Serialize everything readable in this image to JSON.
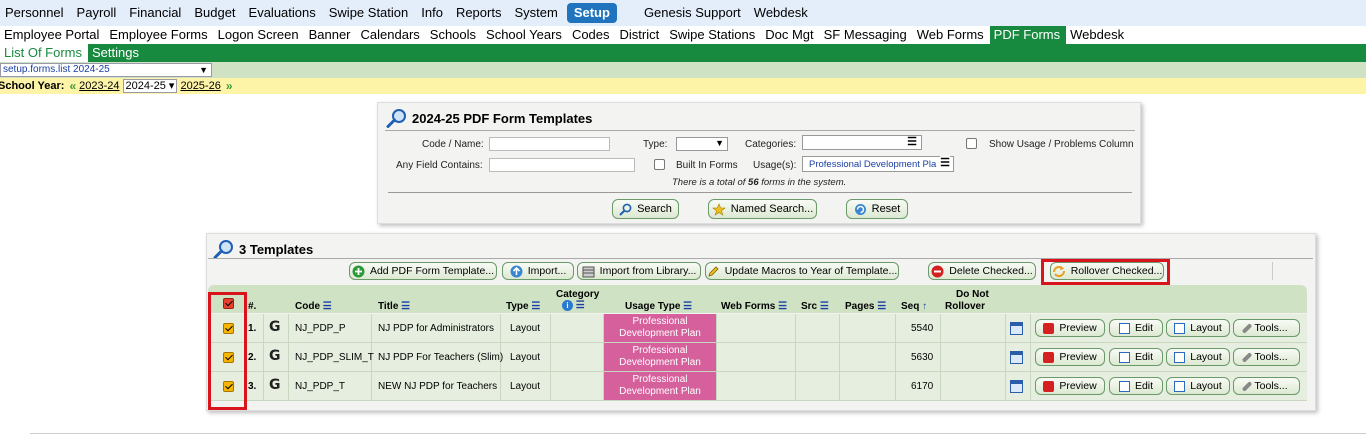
{
  "nav_main": [
    "Personnel",
    "Payroll",
    "Financial",
    "Budget",
    "Evaluations",
    "Swipe Station",
    "Info",
    "Reports",
    "System",
    "Setup",
    "Genesis Support",
    "Webdesk"
  ],
  "nav_main_selected": "Setup",
  "nav_sub": [
    "Employee Portal",
    "Employee Forms",
    "Logon Screen",
    "Banner",
    "Calendars",
    "Schools",
    "School Years",
    "Codes",
    "District",
    "Swipe Stations",
    "Doc Mgt",
    "SF Messaging",
    "Web Forms",
    "PDF Forms",
    "Webdesk"
  ],
  "nav_sub_selected": "PDF Forms",
  "nav_tabs": [
    "List Of Forms",
    "Settings"
  ],
  "nav_tabs_selected": "List Of Forms",
  "path_select": "setup.forms.list 2024-25",
  "school_year": {
    "label": "School Year:",
    "prev": "2023-24",
    "current": "2024-25",
    "next": "2025-26"
  },
  "search_panel": {
    "title": "2024-25 PDF Form Templates",
    "code_name_label": "Code / Name:",
    "type_label": "Type:",
    "categories_label": "Categories:",
    "show_usage_label": "Show Usage / Problems Column",
    "any_field_label": "Any Field Contains:",
    "built_in_label": "Built In Forms",
    "usages_label": "Usage(s):",
    "usages_value": "Professional Development Pla",
    "total_prefix": "There is a total of ",
    "total_count": "56",
    "total_suffix": " forms in the system.",
    "search_btn": "Search",
    "named_search_btn": "Named Search...",
    "reset_btn": "Reset"
  },
  "results": {
    "title": "3 Templates",
    "toolbar": {
      "add": "Add PDF Form Template...",
      "import": "Import...",
      "import_lib": "Import from Library...",
      "update_macros": "Update Macros to Year of Template...",
      "delete": "Delete Checked...",
      "rollover": "Rollover Checked..."
    },
    "headers": {
      "num": "#.",
      "code": "Code",
      "title": "Title",
      "type": "Type",
      "category": "Category",
      "usage_type": "Usage Type",
      "web_forms": "Web Forms",
      "src": "Src",
      "pages": "Pages",
      "seq": "Seq",
      "do_not": "Do Not",
      "rollover": "Rollover"
    },
    "rows": [
      {
        "num": "1.",
        "code": "NJ_PDP_P",
        "title": "NJ PDP for Administrators",
        "type": "Layout",
        "usage1": "Professional",
        "usage2": "Development Plan",
        "seq": "5540"
      },
      {
        "num": "2.",
        "code": "NJ_PDP_SLIM_T",
        "title": "NJ PDP For Teachers (Slim)",
        "type": "Layout",
        "usage1": "Professional",
        "usage2": "Development Plan",
        "seq": "5630"
      },
      {
        "num": "3.",
        "code": "NJ_PDP_T",
        "title": "NEW NJ PDP for Teachers",
        "type": "Layout",
        "usage1": "Professional",
        "usage2": "Development Plan",
        "seq": "6170"
      }
    ],
    "row_buttons": {
      "preview": "Preview",
      "edit": "Edit",
      "layout": "Layout",
      "tools": "Tools..."
    },
    "g_glyph": "G"
  }
}
